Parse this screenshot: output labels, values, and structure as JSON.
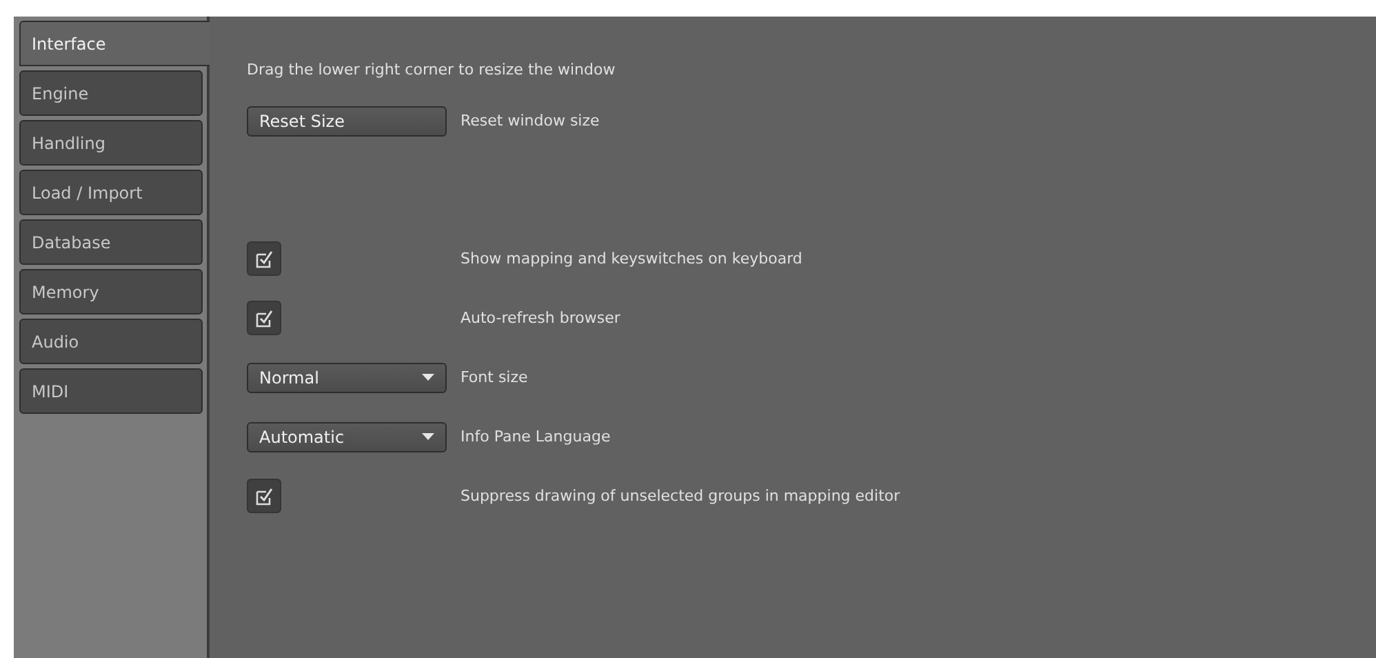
{
  "tabs": [
    {
      "label": "Interface",
      "selected": true
    },
    {
      "label": "Engine",
      "selected": false
    },
    {
      "label": "Handling",
      "selected": false
    },
    {
      "label": "Load / Import",
      "selected": false
    },
    {
      "label": "Database",
      "selected": false
    },
    {
      "label": "Memory",
      "selected": false
    },
    {
      "label": "Audio",
      "selected": false
    },
    {
      "label": "MIDI",
      "selected": false
    }
  ],
  "hint": "Drag the lower right corner to resize the window",
  "settings": [
    {
      "kind": "button",
      "control": "Reset Size",
      "label": "Reset window size"
    },
    {
      "kind": "gap"
    },
    {
      "kind": "checkbox",
      "checked": true,
      "label": "Show mapping and keyswitches on keyboard"
    },
    {
      "kind": "checkbox",
      "checked": true,
      "label": "Auto-refresh browser"
    },
    {
      "kind": "dropdown",
      "control": "Normal",
      "label": "Font size"
    },
    {
      "kind": "dropdown",
      "control": "Automatic",
      "label": "Info Pane Language"
    },
    {
      "kind": "checkbox",
      "checked": true,
      "label": "Suppress drawing of unselected groups in mapping editor"
    }
  ]
}
